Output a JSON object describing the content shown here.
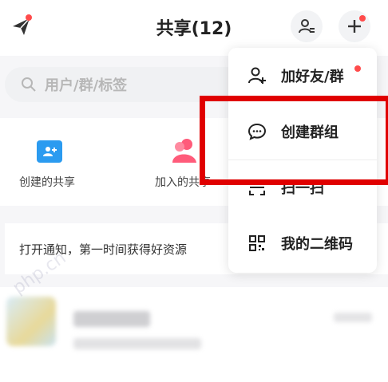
{
  "header": {
    "title": "共享(12)"
  },
  "search": {
    "placeholder": "用户/群/标签"
  },
  "quick": {
    "created": "创建的共享",
    "joined": "加入的共享"
  },
  "notice": {
    "text": "打开通知，第一时间获得好资源"
  },
  "menu": {
    "items": [
      {
        "label": "加好友/群",
        "icon": "add-person-icon"
      },
      {
        "label": "创建群组",
        "icon": "chat-bubble-icon"
      },
      {
        "label": "扫一扫",
        "icon": "scan-icon"
      },
      {
        "label": "我的二维码",
        "icon": "qr-code-icon"
      }
    ]
  },
  "watermark": "php.cn",
  "colors": {
    "accent": "#ff4b4b",
    "highlight": "#e00000",
    "blue": "#2b9bf0",
    "pink": "#ff5b7a"
  }
}
